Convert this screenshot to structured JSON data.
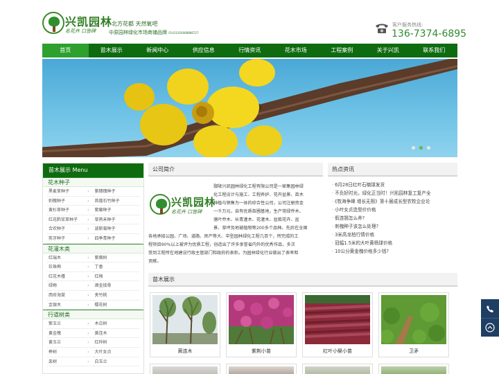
{
  "header": {
    "logo_title": "兴凯园林",
    "logo_sub": "名花卉  口皆碑",
    "slogan": "北方花都  天然氧吧",
    "tagline": "中原园林绿化市场商铺品牌",
    "tagline_num": "01411024068886727",
    "phone_label": "客户服务热线:",
    "phone": "136-7374-6895"
  },
  "nav": [
    "首页",
    "苗木展示",
    "新闻中心",
    "供应信息",
    "行情资讯",
    "花木市场",
    "工程案例",
    "关于兴凯",
    "联系我们"
  ],
  "banner": {
    "slides": 3,
    "active": 2
  },
  "sidebar": {
    "title": "苗木展示 Menu",
    "cats": [
      {
        "name": "花木种子",
        "items": [
          "黑麦草种子",
          "紫穗槐种子",
          "刺槐种子",
          "苜蓿石竹种子",
          "黄杉草种子",
          "紫藤种子",
          "红花酢浆草种子",
          "草熟禾种子",
          "合欢种子",
          "波斯菊种子",
          "剪牙种子",
          "四季青种子"
        ]
      },
      {
        "name": "花灌木类",
        "items": [
          "红瑞木",
          "紫薇树",
          "珍珠梅",
          "丁香",
          "红花木槿",
          "红梅",
          "绿梅",
          "酒金接骨",
          "西府海棠",
          "夹竹桃",
          "金银木",
          "樱花树"
        ]
      },
      {
        "name": "行道树类",
        "items": [
          "紫玉兰",
          "木瓜树",
          "黄金槐",
          "黄连木",
          "黄玉兰",
          "红梓树",
          "榉树",
          "大叶女贞",
          "栾树",
          "白玉兰"
        ]
      }
    ]
  },
  "company": {
    "title": "公司简介",
    "logo_title": "兴凯园林",
    "logo_sub": "名花卉  口皆碑",
    "lines_indent": [
      "鄢陵兴凯园林绿化工程有限公司是一家集园林绿",
      "化工程设计与施工、工程养护、花卉盆景、苗木",
      "种植与销售为一体的综合性公司，公司注册资金",
      "一千万元，自有优质苗圃基地，生产常绿乔木、",
      "落叶乔木、长青灌木、花灌木、盆栽花卉、盆",
      "景、草坪及地被植物等200多个品种。先后在全国"
    ],
    "lines_full": [
      "各地承接公园、广场、道路、房产等大、中型园林绿化工程几百个，所完成的工",
      "程项目90%以上被评为优质工程，创造出了许多享誉省内外的优秀作品，多次",
      "受到工程所在地建设行政主管部门和政府的表彰。为园林绿化行业做出了表率和",
      "贡献。"
    ]
  },
  "news": {
    "title": "热点资讯",
    "items": [
      "6月28日红叶石楠球发货",
      "不负好时光，绿化正当时！兴凯园林复工复产全",
      "《牧海争峰 增长无限》第十届成长型农牧企业论",
      "小叶女贞造型价价格",
      "假连翘怎么养?",
      "刺槐种子该怎么处理?",
      "3米高龙柏行情价格",
      "冠幅1.5米的大叶黄杨球价格",
      "10公分黄金槐价格多少钱?"
    ]
  },
  "products": {
    "title": "苗木展示",
    "items": [
      {
        "name": "黄连木",
        "icon": "tree-photo"
      },
      {
        "name": "紫荆小苗",
        "icon": "redbud-photo"
      },
      {
        "name": "红叶小檗小苗",
        "icon": "barberry-photo"
      },
      {
        "name": "卫矛",
        "icon": "euonymus-photo"
      }
    ]
  },
  "float": {
    "phone_icon": "phone-icon",
    "top_icon": "arrow-up-icon"
  },
  "colors": {
    "nav": "#0f6b10",
    "nav_active": "#2da02d",
    "accent": "#2f8b2f",
    "float": "#1e3e63"
  }
}
